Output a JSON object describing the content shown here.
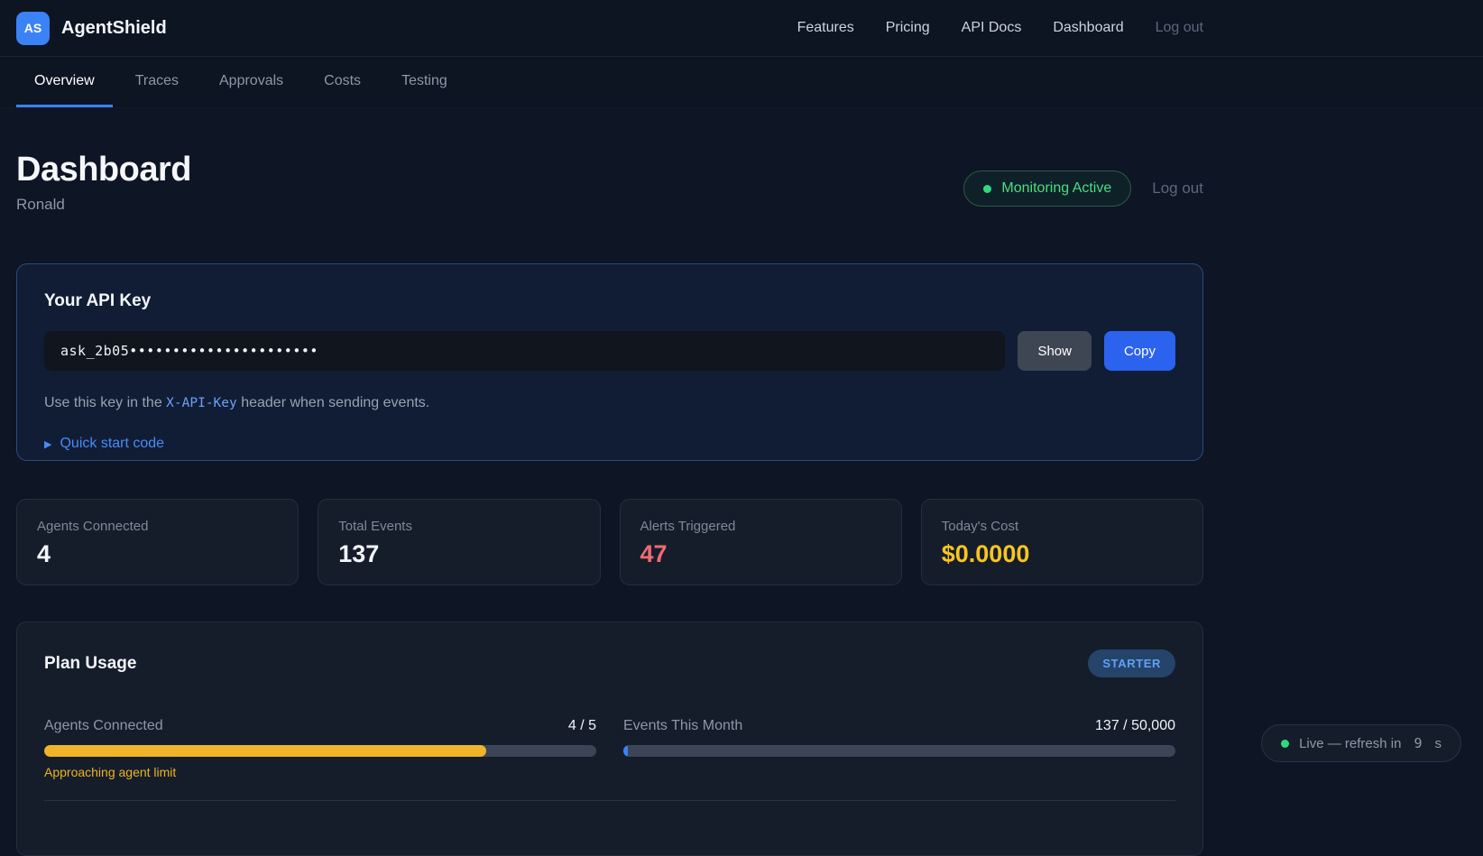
{
  "brand": {
    "logo_text": "AS",
    "name": "AgentShield"
  },
  "nav": {
    "links": [
      {
        "label": "Features"
      },
      {
        "label": "Pricing"
      },
      {
        "label": "API Docs"
      },
      {
        "label": "Dashboard"
      },
      {
        "label": "Log out"
      }
    ]
  },
  "tabs": [
    {
      "label": "Overview",
      "active": true
    },
    {
      "label": "Traces",
      "active": false
    },
    {
      "label": "Approvals",
      "active": false
    },
    {
      "label": "Costs",
      "active": false
    },
    {
      "label": "Testing",
      "active": false
    }
  ],
  "page": {
    "title": "Dashboard",
    "subtitle": "Ronald",
    "status_pill": "Monitoring Active",
    "logout_label": "Log out"
  },
  "api_key": {
    "title": "Your API Key",
    "masked_value": "ask_2b05••••••••••••••••••••••",
    "show_label": "Show",
    "copy_label": "Copy",
    "helper_prefix": "Use this key in the ",
    "helper_code": "X-API-Key",
    "helper_suffix": " header when sending events.",
    "quick_start_icon": "▶",
    "quick_start_label": "Quick start code"
  },
  "stats": [
    {
      "label": "Agents Connected",
      "value": "4",
      "color": "#f3f6fa"
    },
    {
      "label": "Total Events",
      "value": "137",
      "color": "#f3f6fa"
    },
    {
      "label": "Alerts Triggered",
      "value": "47",
      "color": "#f06a72"
    },
    {
      "label": "Today's Cost",
      "value": "$0.0000",
      "color": "#fbc51e"
    }
  ],
  "plan": {
    "title": "Plan Usage",
    "badge": "STARTER",
    "meters": [
      {
        "label": "Agents Connected",
        "value": "4 / 5",
        "percent": 80,
        "fill_style": "width:80%",
        "warning": "Approaching agent limit",
        "bar_color": "#f0b429"
      },
      {
        "label": "Events This Month",
        "value": "137 / 50,000",
        "percent": 0.27,
        "fill_style": "width:0.8%",
        "warning": "",
        "bar_color": "#3b82f6"
      }
    ]
  },
  "live": {
    "prefix": "Live — refresh in",
    "seconds": "9",
    "unit": "s"
  },
  "colors": {
    "accent_blue": "#3b82f6",
    "copy_button": "#2b63ee",
    "show_button": "#3e4653",
    "status_green": "#4ade80",
    "alert_red": "#f06a72",
    "cost_yellow": "#fbc51e",
    "warning_yellow": "#edb41f",
    "card_bg": "#151d2b",
    "api_card_bg": "#101d35",
    "api_card_border": "#2d4a7b",
    "page_bg": "#0e1524"
  }
}
